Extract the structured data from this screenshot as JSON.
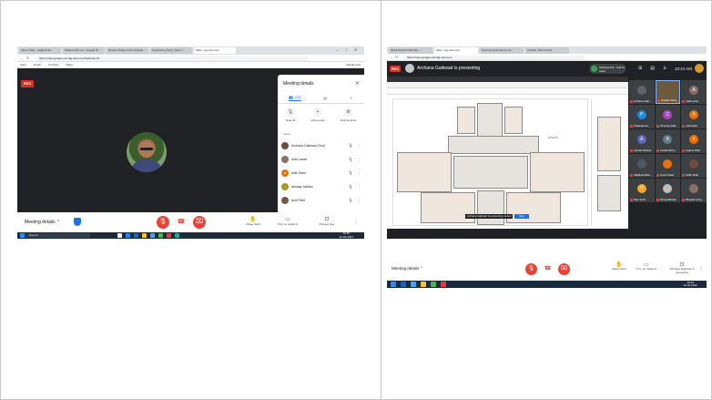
{
  "colors": {
    "meet_red": "#ea4335",
    "accent_blue": "#1a73e8",
    "meet_dark": "#202124"
  },
  "shot1": {
    "tabs": [
      "Inbox (129) - ee@ksrcas...",
      "Shared with me - Google Dr...",
      "Review Subject wise Syllabu...",
      "snapshots_how it_how it...",
      "Meet - ag-vasn-esu"
    ],
    "url": "https://meet.google.com/ag-vasn-esu?authuser=0",
    "bookmarks": [
      "Apps",
      "Gmail",
      "YouTube",
      "Maps"
    ],
    "reading_list": "Reading list",
    "rec": "REC",
    "presenter_name": "Pradish Sathyan",
    "panel_title": "Meeting details",
    "panel_tabs": [
      "(13)",
      "",
      ""
    ],
    "actions": [
      "Mute all",
      "Add people",
      "Host controls"
    ],
    "section": "Active",
    "participants": [
      {
        "name": "Archana Gaikwad (You)",
        "initial": "",
        "color": "#6d4c41"
      },
      {
        "name": "Aditi Lanke",
        "initial": "",
        "color": "#8d6e63"
      },
      {
        "name": "Aditi Sahu",
        "initial": "A",
        "color": "#e8710a"
      },
      {
        "name": "Akshay Jadhav",
        "initial": "",
        "color": "#9e9d24"
      },
      {
        "name": "Amit Patil",
        "initial": "",
        "color": "#795548"
      }
    ],
    "meeting_details": "Meeting details",
    "raise_hand": "Raise hand",
    "captions": "Turn on captions",
    "present": "Present now",
    "search": "Search",
    "clock_time": "10:45",
    "clock_date": "22-03-2021"
  },
  "shot2": {
    "tabs": [
      "Mudit Pinank Informati...",
      "Meet - ag-vasn-esu",
      "Upcoming Homes by Ka...",
      "Untitled -Microsoft.E..."
    ],
    "url": "https://meet.google.com/ag-vasn-esu",
    "rec": "REC",
    "presenting": "Archana Gaikwad is presenting",
    "you_presenting": "Archana Pre.. and 13 more",
    "time": "10:24 AM",
    "toast": "Archana Gaikwad is presenting content",
    "toast_button": "Stop",
    "room_label": "UTILITY",
    "tiles": [
      {
        "name": "Archana Gaik...",
        "initial": "",
        "color": "#5f6368",
        "self": false
      },
      {
        "name": "Pradish Sathy...",
        "initial": "",
        "color": "#6b5a3e",
        "self": true
      },
      {
        "name": "Aditi Lanke",
        "initial": "A",
        "color": "#8d6e63",
        "self": false
      },
      {
        "name": "Pradeeta Ka...",
        "initial": "P",
        "color": "#1e88e5",
        "self": false
      },
      {
        "name": "Chinmayi Mali",
        "initial": "C",
        "color": "#ab47bc",
        "self": false
      },
      {
        "name": "Aditi Sahu",
        "initial": "A",
        "color": "#e8710a",
        "self": false
      },
      {
        "name": "Ashwini Shinde",
        "initial": "A",
        "color": "#5c6bc0",
        "self": false
      },
      {
        "name": "Karthik Mohy...",
        "initial": "K",
        "color": "#607d8b",
        "self": false
      },
      {
        "name": "Kapoor Patil",
        "initial": "K",
        "color": "#ef6c00",
        "self": false
      },
      {
        "name": "Siddhesh Bha...",
        "initial": "",
        "color": "#455a64",
        "self": false
      },
      {
        "name": "Ayush Shaw",
        "initial": "",
        "color": "#e8710a",
        "self": false
      },
      {
        "name": "Nidhi Shah",
        "initial": "",
        "color": "#6d4c41",
        "self": false
      },
      {
        "name": "Dipti Joshi",
        "initial": "D",
        "color": "#f9a825",
        "self": false
      },
      {
        "name": "Shreya Bhosle",
        "initial": "",
        "color": "#bdbdbd",
        "self": false
      },
      {
        "name": "Bhaskar Garg",
        "initial": "",
        "color": "#8d6e63",
        "self": false
      }
    ],
    "meeting_details": "Meeting details",
    "raise_hand": "Raise hand",
    "captions": "Turn on captions",
    "present": "Archana Gaikwad is presenting",
    "clock_time": "10:24",
    "clock_date": "22-03-2021"
  }
}
